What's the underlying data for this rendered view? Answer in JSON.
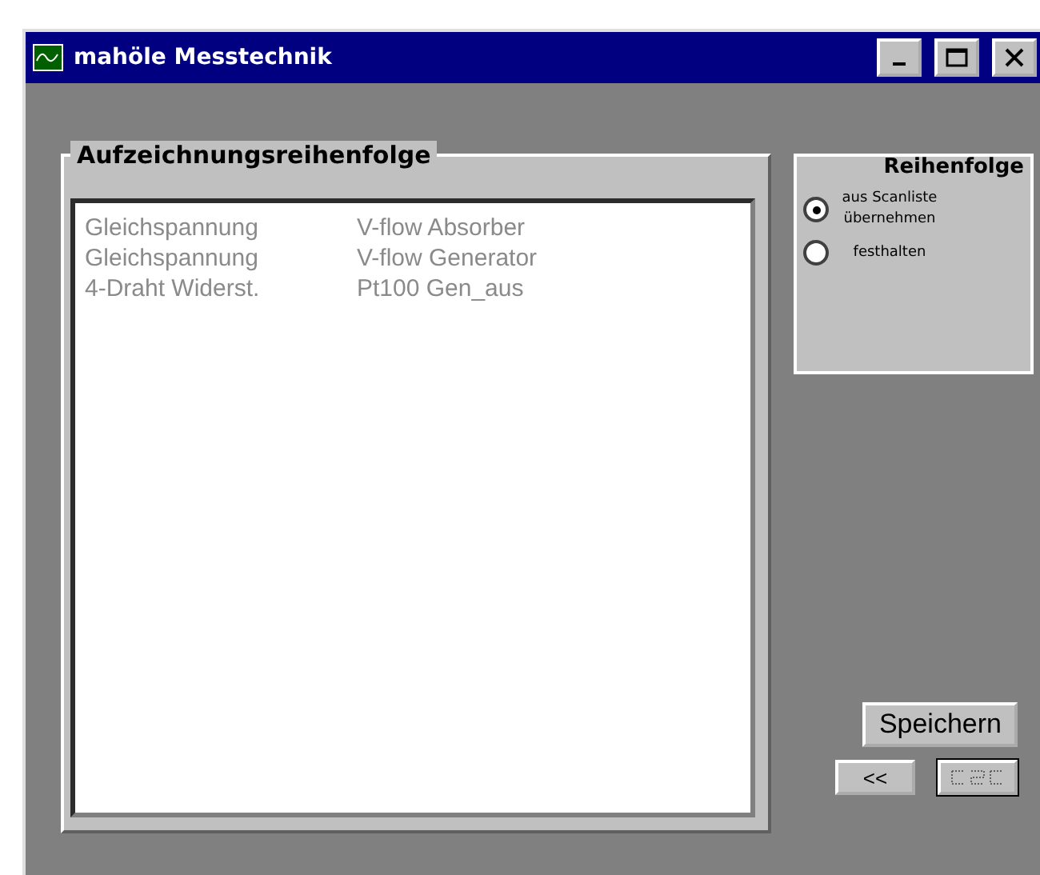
{
  "window": {
    "title": "mahöle Messtechnik"
  },
  "record_order": {
    "title": "Aufzeichnungsreihenfolge",
    "rows": [
      {
        "column_1": "Gleichspannung",
        "column_2": "V-flow Absorber"
      },
      {
        "column_1": "Gleichspannung",
        "column_2": "V-flow Generator"
      },
      {
        "column_1": "4-Draht Widerst.",
        "column_2": "Pt100 Gen_aus"
      }
    ]
  },
  "order": {
    "title": "Reihenfolge",
    "options": [
      {
        "label": "aus Scanliste übernehmen",
        "selected": true
      },
      {
        "label": "festhalten",
        "selected": false
      }
    ]
  },
  "buttons": {
    "save": "Speichern",
    "back": "<<",
    "disabled": {
      "disabled": true
    }
  }
}
